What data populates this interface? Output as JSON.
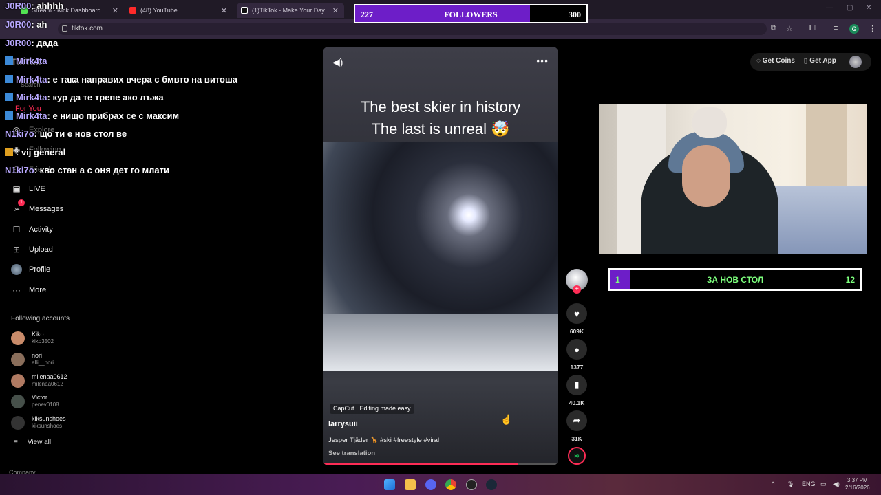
{
  "browser": {
    "tabs": [
      {
        "label": "Stream - Kick Dashboard",
        "color": "#52e252"
      },
      {
        "label": "(48) YouTube",
        "color": "#ff2a2a"
      },
      {
        "label": "(1)TikTok - Make Your Day",
        "color": "#ffffff"
      }
    ],
    "url": "tiktok.com"
  },
  "chat": [
    {
      "user": "J0R00",
      "msg": ": ahhhh",
      "badge": false
    },
    {
      "user": "J0R00",
      "msg": ": ah",
      "badge": false
    },
    {
      "user": "J0R00",
      "msg": ": дада",
      "badge": false
    },
    {
      "user": "Mirk4ta",
      "msg": "",
      "badge": true
    },
    {
      "user": "Mirk4ta",
      "msg": ": е така направих вчера с бмвто на витоша",
      "badge": true
    },
    {
      "user": "Mirk4ta",
      "msg": ": кур да те трепе ако лъжа",
      "badge": true
    },
    {
      "user": "Mirk4ta",
      "msg": ": е нищо прибрах се с максим",
      "badge": true
    },
    {
      "user": "N1ki7o",
      "msg": ": що ти е нов стол ве",
      "badge": false
    },
    {
      "user": "",
      "msg": ": vij general",
      "badge": true
    },
    {
      "user": "N1ki7o",
      "msg": ": кво стан а с оня дет го млати",
      "badge": false
    }
  ],
  "followers": {
    "current": "227",
    "label": "FOLLOWERS",
    "goal": "300",
    "progress": 0.757
  },
  "sidebar": {
    "logo": "TikTok",
    "search": "Search",
    "items": [
      {
        "label": "For You",
        "icon": "home-icon"
      },
      {
        "label": "Explore",
        "icon": "compass-icon"
      },
      {
        "label": "Following",
        "icon": "following-icon"
      },
      {
        "label": "Friends",
        "icon": "friends-icon"
      },
      {
        "label": "LIVE",
        "icon": "live-icon"
      },
      {
        "label": "Messages",
        "icon": "messages-icon"
      },
      {
        "label": "Activity",
        "icon": "activity-icon"
      },
      {
        "label": "Upload",
        "icon": "upload-icon"
      },
      {
        "label": "Profile",
        "icon": "profile-icon"
      },
      {
        "label": "More",
        "icon": "more-icon"
      }
    ],
    "messages_badge": "1",
    "following_title": "Following accounts",
    "accounts": [
      {
        "name": "Kiko",
        "handle": "kiko3502",
        "color": "#c98b6a"
      },
      {
        "name": "nori",
        "handle": "elli__nori",
        "color": "#8a6e5b"
      },
      {
        "name": "milenaa0612",
        "handle": "milenaa0612",
        "color": "#b07a62"
      },
      {
        "name": "Victor",
        "handle": "penev0108",
        "color": "#46504a"
      },
      {
        "name": "kiksunshoes",
        "handle": "kiksunshoes",
        "color": "#333333"
      }
    ],
    "view_all": "View all",
    "company": "Company"
  },
  "video": {
    "caption_line1": "The best skier in history",
    "caption_line2": "The last is unreal 🤯",
    "capcut": "CapCut · Editing made easy",
    "author": "larrysuii",
    "description": "Jesper Tjäder 🦒 #ski #freestyle #viral",
    "see_translation": "See translation",
    "progress": 0.83
  },
  "actions": {
    "likes": "609K",
    "comments": "1377",
    "saves": "40.1K",
    "shares": "31K"
  },
  "topright": {
    "coins": "Get Coins",
    "app": "Get App"
  },
  "goal": {
    "current": "1",
    "label": "ЗА НОВ СТОЛ",
    "target": "12",
    "progress": 0.083
  },
  "taskbar": {
    "lang": "ENG",
    "time": "3:37 PM",
    "date": "2/16/2026"
  }
}
